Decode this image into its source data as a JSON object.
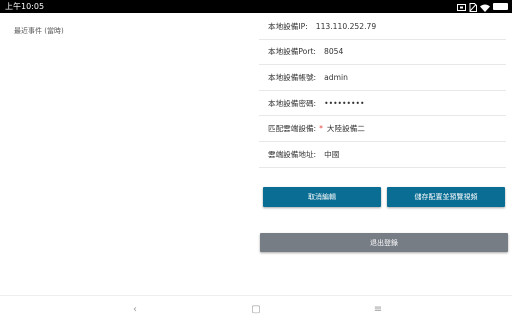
{
  "status_bar": {
    "time": "上午10:05",
    "icons": [
      "screen-mirror-icon",
      "no-sim-icon",
      "wifi-icon",
      "battery-icon"
    ]
  },
  "left_panel": {
    "title": "最近事件 (當時)"
  },
  "form": {
    "rows": [
      {
        "label": "本地設備IP:",
        "value": "113.110.252.79"
      },
      {
        "label": "本地設備Port:",
        "value": "8054"
      },
      {
        "label": "本地設備帳號:",
        "value": "admin"
      },
      {
        "label": "本地設備密碼:",
        "value": "•••••••••"
      },
      {
        "label": "匹配雲端設備:",
        "required_mark": "*",
        "value": "大陸設備二"
      },
      {
        "label": "雲端設備地址:",
        "value": "中國"
      }
    ]
  },
  "buttons": {
    "cancel_label": "取消編輯",
    "save_label": "儲存配置並預覽視頻",
    "logout_label": "退出登錄"
  },
  "nav_bar": {
    "back_glyph": "‹",
    "home_glyph": "▢",
    "menu_glyph": "≡"
  },
  "colors": {
    "primary_button": "#0a6d94",
    "logout_button": "#767d85",
    "required": "#e53935",
    "status_bar": "#000000"
  }
}
